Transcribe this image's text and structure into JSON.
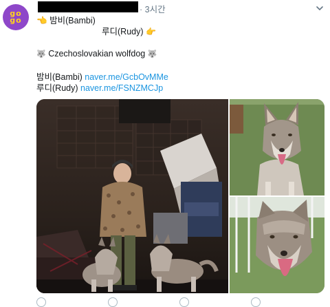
{
  "tweet": {
    "avatar": {
      "text": "go go",
      "color": "#8e47c9",
      "text_color": "#ffd21f"
    },
    "time": "· 3시간",
    "icons": {
      "more": "chevron-down-icon",
      "point_right": "pointing-right-icon",
      "point_left": "pointing-left-icon",
      "wolf": "wolf-face-icon"
    },
    "lines": {
      "bambi": "밤비(Bambi)",
      "rudy": "루디(Rudy)",
      "breed": "Czechoslovakian wolfdog",
      "bambi_label": "밤비(Bambi)",
      "bambi_link": "naver.me/GcbOvMMe",
      "rudy_label": "루디(Rudy)",
      "rudy_link": "naver.me/FSNZMCJp"
    },
    "emoji": {
      "point_right": "👈",
      "point_left": "👉",
      "wolf": "🐺"
    },
    "colors": {
      "link": "#1b95e0",
      "muted": "#657786"
    }
  }
}
